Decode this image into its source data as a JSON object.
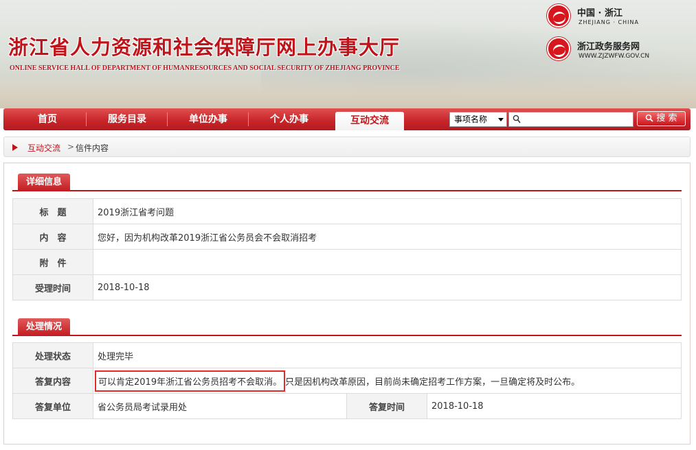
{
  "header": {
    "title": "浙江省人力资源和社会保障厅网上办事大厅",
    "subtitle": "ONLINE SERVICE HALL OF DEPARTMENT OF HUMANRESOURCES AND SOCIAL SECURITY OF ZHEJIANG PROVINCE",
    "logo1_text": "中国 · 浙江",
    "logo1_subtext": "ZHEJIANG · CHINA",
    "logo2_text": "浙江政务服务网",
    "logo2_subtext": "WWW.ZJZWFW.GOV.CN"
  },
  "nav": {
    "items": [
      {
        "label": "首页"
      },
      {
        "label": "服务目录"
      },
      {
        "label": "单位办事"
      },
      {
        "label": "个人办事"
      },
      {
        "label": "互动交流"
      }
    ],
    "active_index": 4
  },
  "search": {
    "select_value": "事项名称",
    "input_value": "",
    "button_label": "搜 索"
  },
  "breadcrumb": {
    "link": "互动交流",
    "separator": ">",
    "current": "信件内容"
  },
  "detail": {
    "section_title": "详细信息",
    "rows": [
      {
        "label": "标　题",
        "value": "2019浙江省考问题"
      },
      {
        "label": "内　容",
        "value": "您好，因为机构改革2019浙江省公务员会不会取消招考"
      },
      {
        "label": "附　件",
        "value": ""
      },
      {
        "label": "受理时间",
        "value": "2018-10-18"
      }
    ]
  },
  "processing": {
    "section_title": "处理情况",
    "status_label": "处理状态",
    "status_value": "处理完毕",
    "reply_label": "答复内容",
    "reply_highlight": "可以肯定2019年浙江省公务员招考不会取消。",
    "reply_rest": "只是因机构改革原因，目前尚未确定招考工作方案，一旦确定将及时公布。",
    "unit_label": "答复单位",
    "unit_value": "省公务员局考试录用处",
    "time_label": "答复时间",
    "time_value": "2018-10-18"
  },
  "colors": {
    "brand_red": "#c0141b",
    "highlight_border": "#e02b2b"
  }
}
